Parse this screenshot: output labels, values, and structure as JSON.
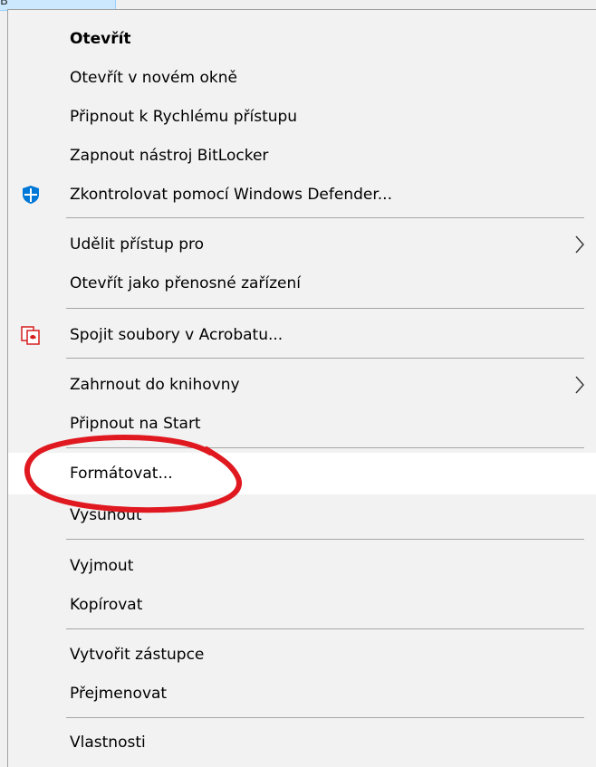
{
  "background": {
    "selection_color": "#cce8ff",
    "partial_letter": "B"
  },
  "menu": {
    "items": [
      {
        "label": "Otevřít",
        "bold": true
      },
      {
        "label": "Otevřít v novém okně"
      },
      {
        "label": "Připnout k Rychlému přístupu"
      },
      {
        "label": "Zapnout nástroj BitLocker"
      },
      {
        "label": "Zkontrolovat pomocí Windows Defender...",
        "icon": "windows-defender-shield-icon"
      },
      {
        "label": "Udělit přístup pro",
        "submenu": true
      },
      {
        "label": "Otevřít jako přenosné zařízení"
      },
      {
        "label": "Spojit soubory v Acrobatu...",
        "icon": "acrobat-combine-files-icon"
      },
      {
        "label": "Zahrnout do knihovny",
        "submenu": true
      },
      {
        "label": "Připnout na Start"
      },
      {
        "label": "Formátovat...",
        "highlighted": true
      },
      {
        "label": "Vysunout"
      },
      {
        "label": "Vyjmout"
      },
      {
        "label": "Kopírovat"
      },
      {
        "label": "Vytvořit zástupce"
      },
      {
        "label": "Přejmenovat"
      },
      {
        "label": "Vlastnosti"
      }
    ]
  },
  "annotation": {
    "shape": "hand-drawn ellipse",
    "color": "#e0181f",
    "target": "Formátovat..."
  },
  "colors": {
    "menu_background": "#f2f2f2",
    "highlight": "#ffffff",
    "separator": "#a6a6a6",
    "defender_blue": "#0078d7",
    "acrobat_red": "#d51e1e"
  }
}
